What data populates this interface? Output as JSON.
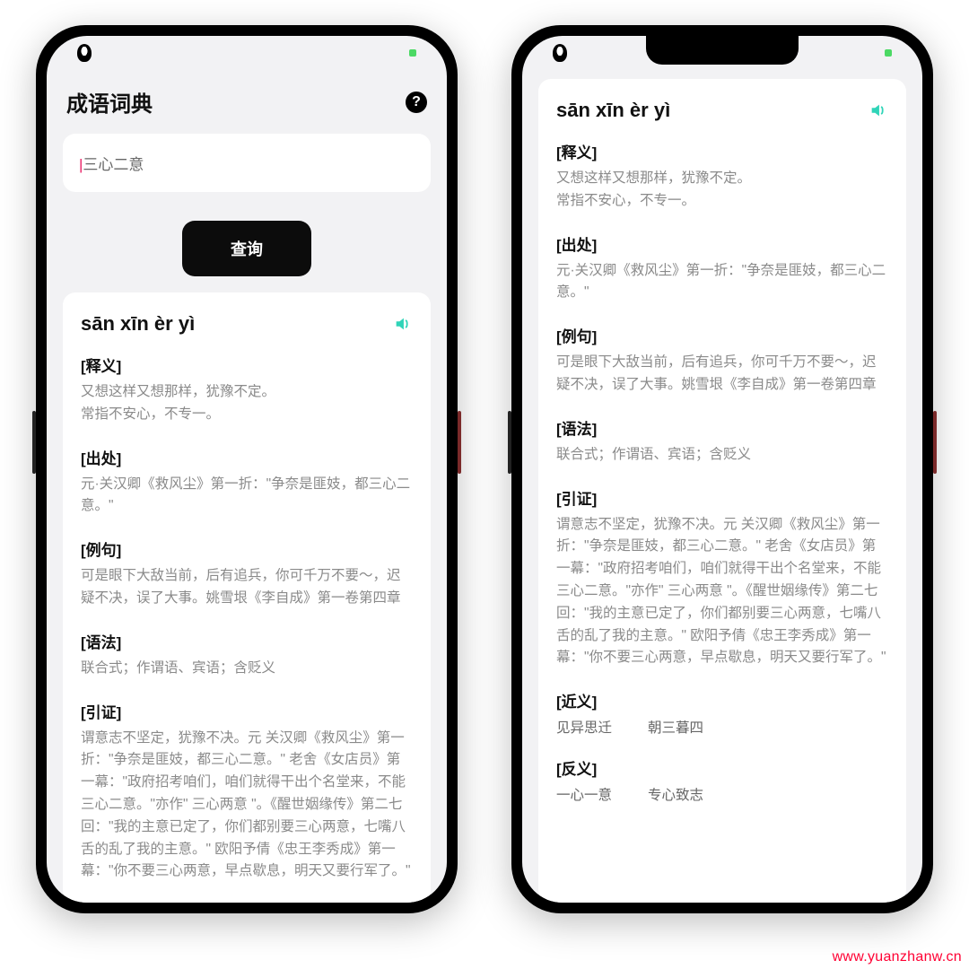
{
  "watermark": "www.yuanzhanw.cn",
  "app": {
    "title": "成语词典",
    "search_value": "三心二意",
    "query_button": "查询"
  },
  "entry": {
    "pinyin": "sān xīn èr yì",
    "sections": [
      {
        "label": "[释义]",
        "body": "又想这样又想那样，犹豫不定。\n常指不安心，不专一。"
      },
      {
        "label": "[出处]",
        "body": "元·关汉卿《救风尘》第一折：\"争奈是匪妓，都三心二意。\""
      },
      {
        "label": "[例句]",
        "body": "可是眼下大敌当前，后有追兵，你可千万不要～，迟疑不决，误了大事。姚雪垠《李自成》第一卷第四章"
      },
      {
        "label": "[语法]",
        "body": "联合式；作谓语、宾语；含贬义"
      },
      {
        "label": "[引证]",
        "body": "谓意志不坚定，犹豫不决。元 关汉卿《救风尘》第一折：\"争奈是匪妓，都三心二意。\" 老舍《女店员》第一幕：\"政府招考咱们，咱们就得干出个名堂来，不能三心二意。\"亦作\" 三心两意 \"。《醒世姻缘传》第二七回：\"我的主意已定了，你们都别要三心两意，七嘴八舌的乱了我的主意。\" 欧阳予倩《忠王李秀成》第一幕：\"你不要三心两意，早点歇息，明天又要行军了。\""
      }
    ],
    "synonym_label": "[近义]",
    "synonyms": [
      "见异思迁",
      "朝三暮四"
    ],
    "antonym_label": "[反义]",
    "antonyms": [
      "一心一意",
      "专心致志"
    ]
  }
}
